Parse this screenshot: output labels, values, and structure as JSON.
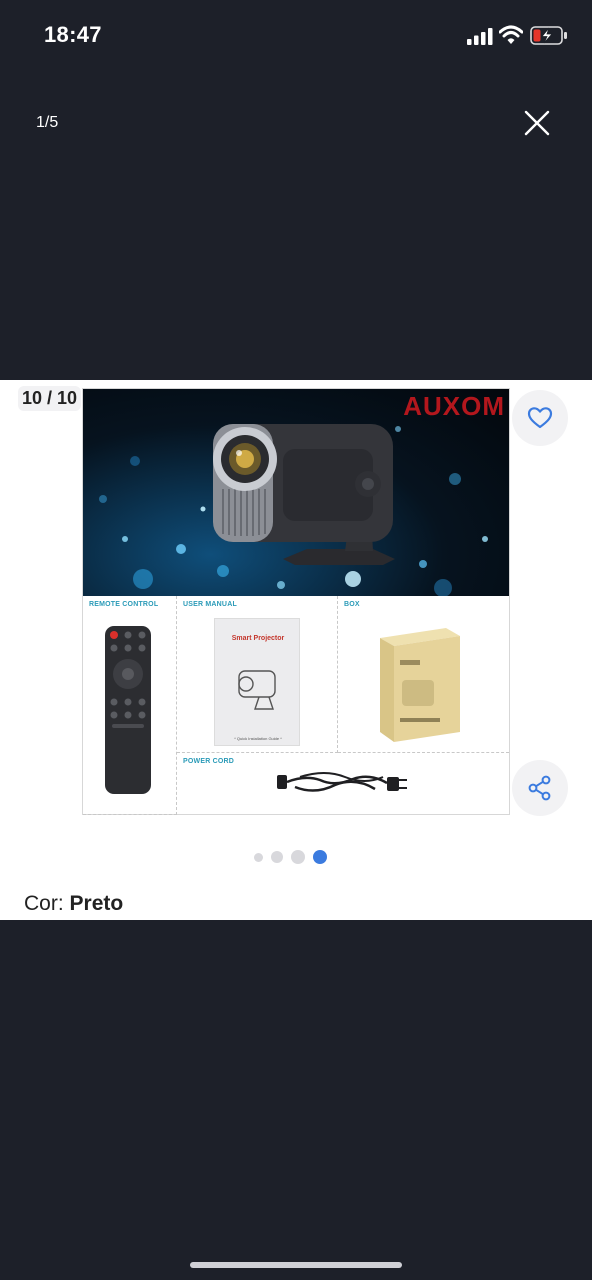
{
  "status_bar": {
    "time": "18:47",
    "icons": [
      "cellular-signal-icon",
      "wifi-icon",
      "battery-charging-icon"
    ],
    "battery_level": 0.15,
    "battery_color": "#e5352b"
  },
  "viewer": {
    "counter": "1/5",
    "close_icon": "close-icon"
  },
  "product": {
    "image_index": "10 / 10",
    "image": {
      "brand": "AUXOM",
      "panels": {
        "remote": "REMOTE CONTROL",
        "manual": "USER MANUAL",
        "manual_title": "Smart Projector",
        "manual_footer": "* Quick Installation Guide *",
        "box": "BOX",
        "cord": "POWER CORD"
      }
    },
    "favorite_icon": "heart-icon",
    "share_icon": "share-icon",
    "dots": {
      "count": 4,
      "active": 3,
      "active_color": "#3b7bdf"
    },
    "color_label": "Cor:",
    "color_value": "Preto"
  }
}
